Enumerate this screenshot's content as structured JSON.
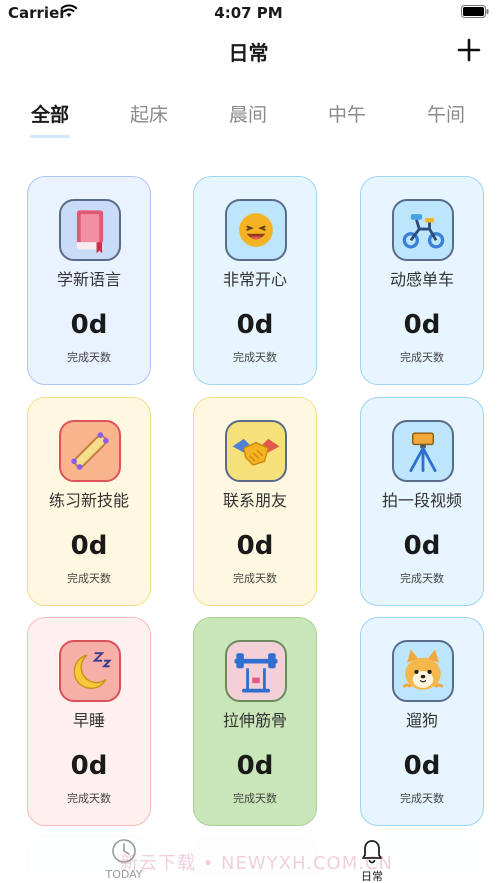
{
  "status_bar": {
    "carrier": "Carrier",
    "time": "4:07 PM"
  },
  "nav": {
    "title": "日常"
  },
  "tabs": [
    {
      "label": "全部",
      "active": true
    },
    {
      "label": "起床"
    },
    {
      "label": "晨间"
    },
    {
      "label": "中午"
    },
    {
      "label": "午间"
    }
  ],
  "cards": [
    {
      "title": "学新语言",
      "days": "0d",
      "sub": "完成天数",
      "icon": "book-icon",
      "bg": "#eaf1ff",
      "border": "#aec6f3"
    },
    {
      "title": "非常开心",
      "days": "0d",
      "sub": "完成天数",
      "icon": "laughing-face-icon",
      "bg": "#e6f5fe",
      "border": "#9fd4f5"
    },
    {
      "title": "动感单车",
      "days": "0d",
      "sub": "完成天数",
      "icon": "bicycle-icon",
      "bg": "#e6f5fe",
      "border": "#9fd4f5"
    },
    {
      "title": "练习新技能",
      "days": "0d",
      "sub": "完成天数",
      "icon": "skateboard-icon",
      "bg": "#fff8e1",
      "border": "#f6dc8b"
    },
    {
      "title": "联系朋友",
      "days": "0d",
      "sub": "完成天数",
      "icon": "handshake-icon",
      "bg": "#fff8e1",
      "border": "#f6dc8b"
    },
    {
      "title": "拍一段视频",
      "days": "0d",
      "sub": "完成天数",
      "icon": "camera-tripod-icon",
      "bg": "#e6f5fe",
      "border": "#9fd4f5"
    },
    {
      "title": "早睡",
      "days": "0d",
      "sub": "完成天数",
      "icon": "moon-sleep-icon",
      "bg": "#fff0f0",
      "border": "#f6bcbc"
    },
    {
      "title": "拉伸筋骨",
      "days": "0d",
      "sub": "完成天数",
      "icon": "barbell-icon",
      "bg": "#c9e6b9",
      "border": "#a9d095"
    },
    {
      "title": "遛狗",
      "days": "0d",
      "sub": "完成天数",
      "icon": "dog-icon",
      "bg": "#e6f5fe",
      "border": "#9fd4f5"
    }
  ],
  "tab_bar": {
    "items": [
      {
        "label": "TODAY",
        "icon": "clock-icon"
      },
      {
        "label": "日常",
        "icon": "bell-icon",
        "active": true
      }
    ],
    "watermark": "新云下载 • NEWYXH.COM.CN"
  }
}
